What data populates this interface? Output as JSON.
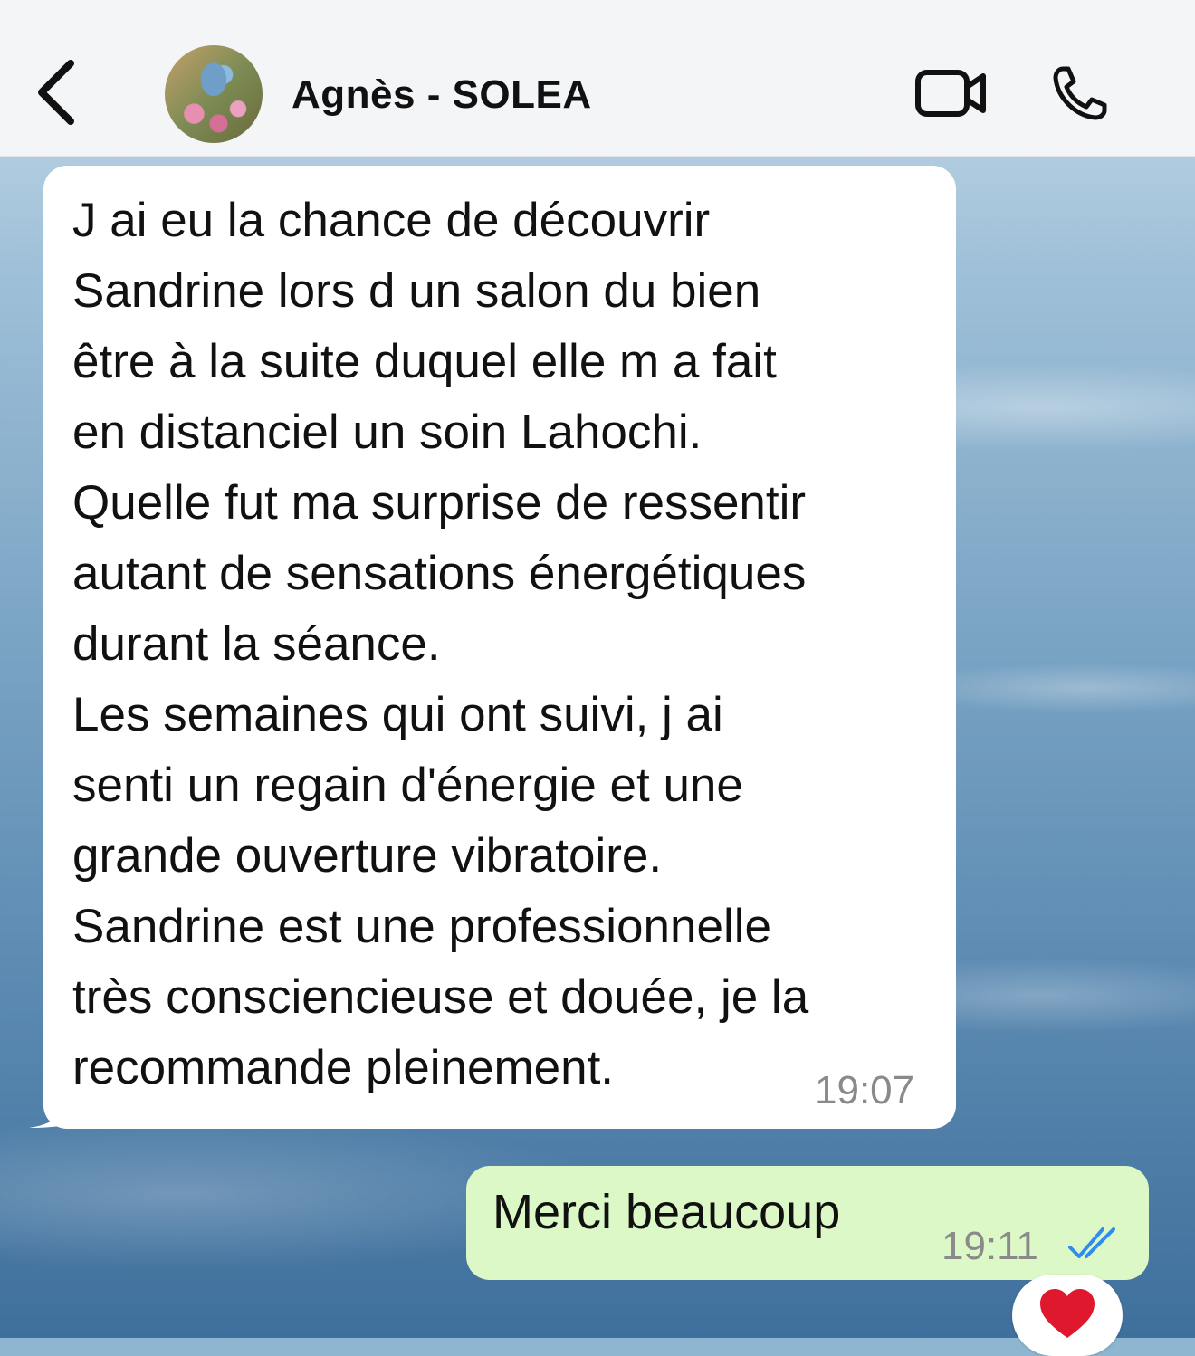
{
  "header": {
    "contact_name": "Agnès - SOLEA",
    "back_icon": "chevron-left-icon",
    "video_icon": "video-camera-icon",
    "call_icon": "phone-icon"
  },
  "messages": [
    {
      "direction": "incoming",
      "text": "J ai eu la chance de découvrir\nSandrine lors d un salon du bien\nêtre à la suite duquel elle m a fait\nen distanciel un soin Lahochi.\nQuelle fut ma surprise de ressentir\nautant de sensations énergétiques\ndurant la séance.\nLes semaines qui ont suivi, j ai\nsenti un regain d'énergie et une\ngrande ouverture vibratoire.\nSandrine est une professionnelle\ntrès consciencieuse et douée, je la\nrecommande pleinement.",
      "time": "19:07"
    },
    {
      "direction": "outgoing",
      "text": "Merci beaucoup",
      "time": "19:11",
      "status_icon": "double-check-read-icon",
      "reaction": "red-heart"
    }
  ],
  "colors": {
    "header_bg": "#f4f5f7",
    "incoming_bubble": "#ffffff",
    "outgoing_bubble": "#dcf8c6",
    "read_ticks": "#2f8cf0",
    "heart": "#e0182e"
  }
}
